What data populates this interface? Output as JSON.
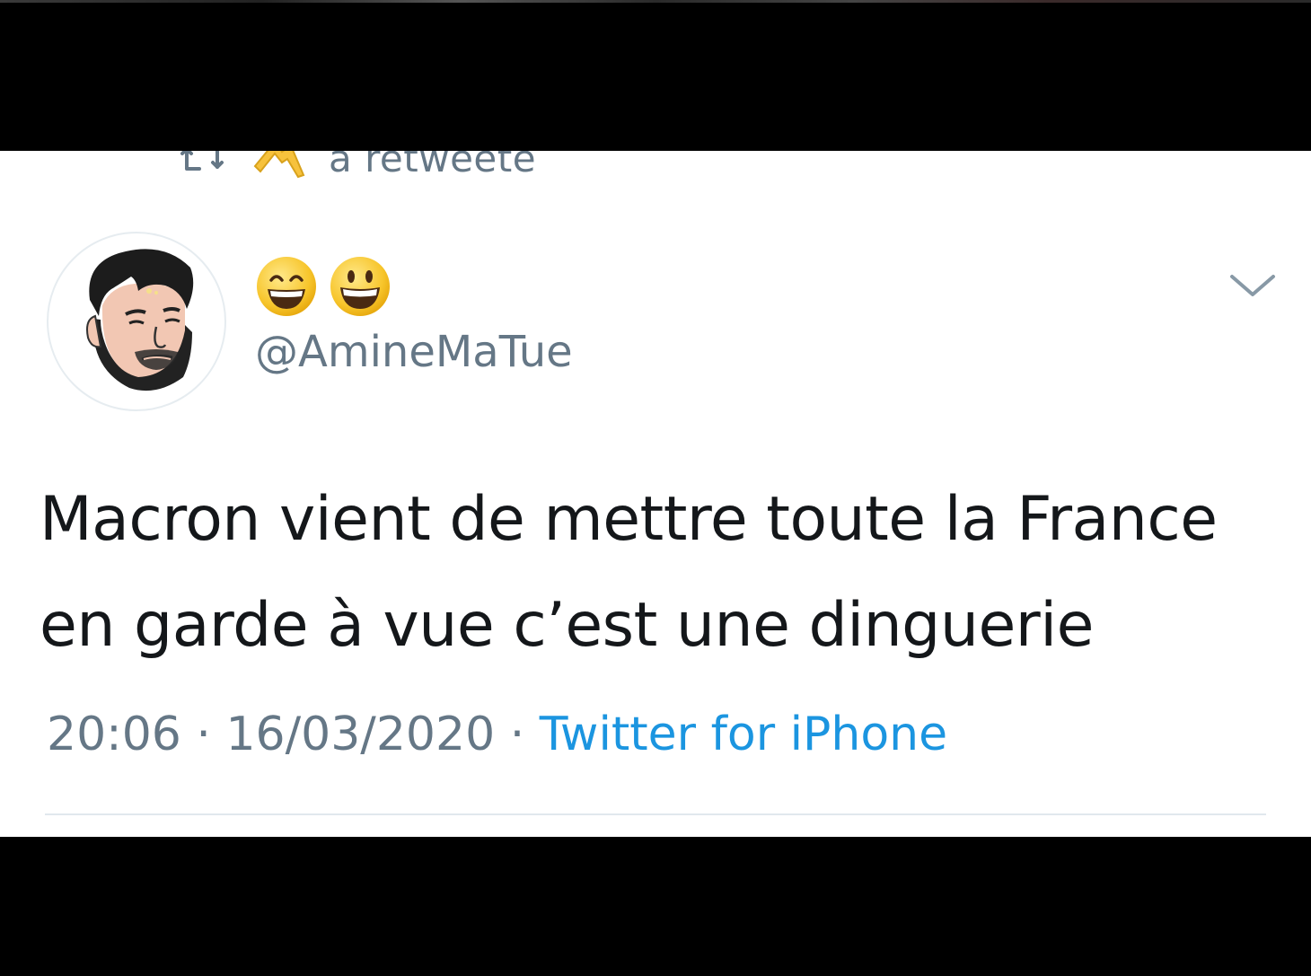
{
  "retweet": {
    "label": "a retweeté",
    "icon": "retweet-icon",
    "retweeter_avatar": "raised-hands-emoji"
  },
  "author": {
    "display_name_emojis": [
      "grinning-squinting-face-emoji",
      "grinning-face-emoji"
    ],
    "handle": "@AmineMaTue",
    "avatar": "cartoon-portrait"
  },
  "tweet": {
    "text_line1": "Macron vient de mettre toute la France",
    "text_line2": "en garde à vue c’est une dinguerie"
  },
  "meta": {
    "time": "20:06",
    "separator1": " · ",
    "date": "16/03/2020",
    "separator2": " · ",
    "source": "Twitter for iPhone"
  },
  "colors": {
    "text": "#14171a",
    "muted": "#657786",
    "link": "#1b95e0",
    "divider": "#e1e8ed",
    "letterbox": "#000000"
  }
}
